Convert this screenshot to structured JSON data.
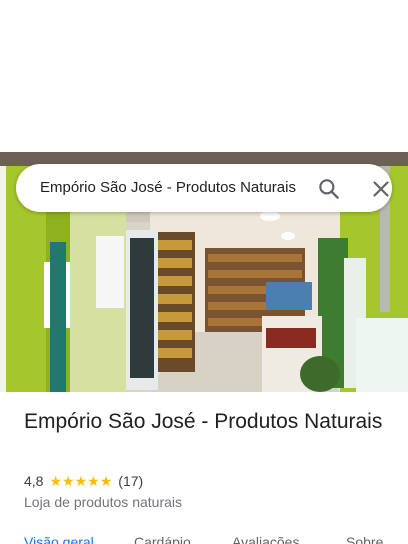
{
  "search": {
    "value": "Empório São José - Produtos Naturais"
  },
  "place": {
    "name": "Empório São José - Produtos Naturais",
    "rating": "4,8",
    "stars_filled": 5,
    "review_count": "(17)",
    "category": "Loja de produtos naturais"
  },
  "tabs": [
    {
      "label": "Visão geral",
      "active": true
    },
    {
      "label": "Cardápio",
      "active": false
    },
    {
      "label": "Avaliações",
      "active": false
    },
    {
      "label": "Sobre",
      "active": false
    }
  ],
  "colors": {
    "accent": "#1a73e8",
    "star": "#fbbc04",
    "storefront_green": "#9cc22b"
  },
  "icons": {
    "search": "search-icon",
    "close": "close-icon",
    "star": "star-icon"
  }
}
